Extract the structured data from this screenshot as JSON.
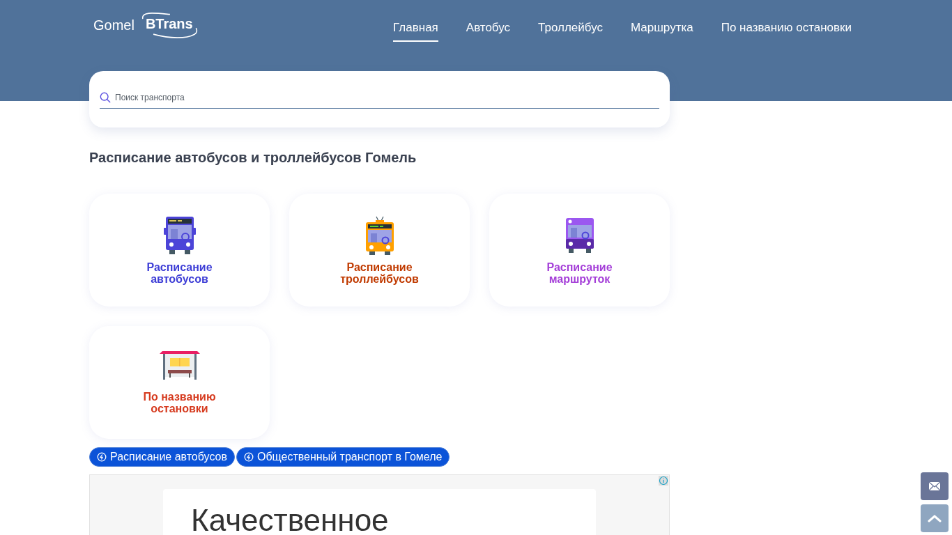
{
  "logo": {
    "part_1": "Gomel",
    "part_2": "BTrans"
  },
  "nav": [
    {
      "label": "Главная",
      "selected": true
    },
    {
      "label": "Автобус",
      "selected": false
    },
    {
      "label": "Троллейбус",
      "selected": false
    },
    {
      "label": "Маршрутка",
      "selected": false
    },
    {
      "label": "По названию остановки",
      "selected": false
    }
  ],
  "search": {
    "placeholder": "Поиск транспорта"
  },
  "heading": "Расписание автобусов и троллейбусов Гомель",
  "cards": [
    {
      "kind": "bus",
      "label": "Расписание автобусов",
      "color": "#3d3dd6"
    },
    {
      "kind": "trolleybus",
      "label": "Расписание троллейбусов",
      "color": "#c03a00"
    },
    {
      "kind": "minibus",
      "label": "Расписание маршруток",
      "color": "#a43ed8"
    },
    {
      "kind": "stop",
      "label": "По названию остановки",
      "color": "#d63a1e"
    }
  ],
  "chips": [
    "Расписание автобусов",
    "Общественный транспорт в Гомеле"
  ],
  "ad": {
    "headline": "Качественное"
  }
}
